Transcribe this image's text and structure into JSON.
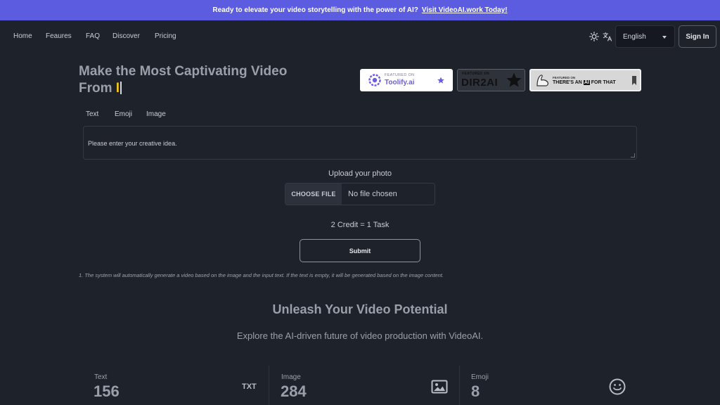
{
  "banner": {
    "text": "Ready to elevate your video storytelling with the power of AI?",
    "link": "Visit VideoAI.work Today!"
  },
  "nav": {
    "links": [
      "Home",
      "Feaures",
      "FAQ",
      "Discover",
      "Pricing"
    ],
    "language": "English",
    "signin": "Sign In"
  },
  "hero": {
    "title_line1": "Make the Most Captivating Video",
    "title_line2": "From",
    "typed": "I"
  },
  "badges": {
    "toolify": {
      "featured": "FEATURED ON",
      "name": "Toolify.ai"
    },
    "dir2ai": {
      "featured": "FEATURED ON",
      "name": "DIR2AI"
    },
    "aifor": {
      "featured": "FEATURED ON",
      "name_pre": "THERE'S AN",
      "name_ai": "AI",
      "name_post": "FOR THAT"
    }
  },
  "tabs": [
    "Text",
    "Emoji",
    "Image"
  ],
  "form": {
    "idea_placeholder": "Please enter your creative idea.",
    "upload_label": "Upload your photo",
    "choose_file": "CHOOSE FILE",
    "file_status": "No file chosen",
    "credit": "2 Credit = 1 Task",
    "submit": "Submit",
    "note": "1. The system will automatically generate a video based on the image and the input text. If the text is empty, it will be generated based on the image content."
  },
  "section": {
    "title": "Unleash Your Video Potential",
    "subtitle": "Explore the AI-driven future of video production with VideoAI."
  },
  "stats": [
    {
      "label": "Text",
      "value": "156",
      "icon": "TXT"
    },
    {
      "label": "Image",
      "value": "284",
      "icon": "image-icon"
    },
    {
      "label": "Emoji",
      "value": "8",
      "icon": "smiley-icon"
    }
  ],
  "colors": {
    "background": "#1e222b",
    "banner": "#5b5ce0",
    "accent_typed": "#f0c419",
    "toolify_purple": "#6b5be6"
  }
}
